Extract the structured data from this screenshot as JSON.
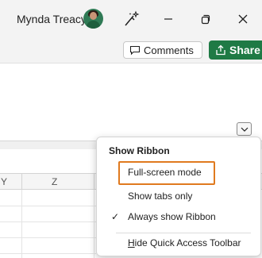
{
  "titlebar": {
    "user_name": "Mynda Treacy",
    "icons": [
      "avatar",
      "magic-wand-icon",
      "minimize-icon",
      "restore-icon",
      "close-icon"
    ]
  },
  "ribbon": {
    "comments_label": "Comments",
    "share_label": "Share",
    "share_color": "#1f7a45"
  },
  "columns": [
    "Y",
    "Z"
  ],
  "menu": {
    "heading": "Show Ribbon",
    "items": [
      {
        "label": "Full-screen mode",
        "checked": false,
        "highlighted": true
      },
      {
        "label": "Show tabs only",
        "checked": false
      },
      {
        "label": "Always show Ribbon",
        "checked": true,
        "check_glyph": "✓"
      },
      {
        "label_underlined": "H",
        "label_rest": "ide Quick Access Toolbar"
      }
    ],
    "highlight_color": "#e07a1f"
  }
}
